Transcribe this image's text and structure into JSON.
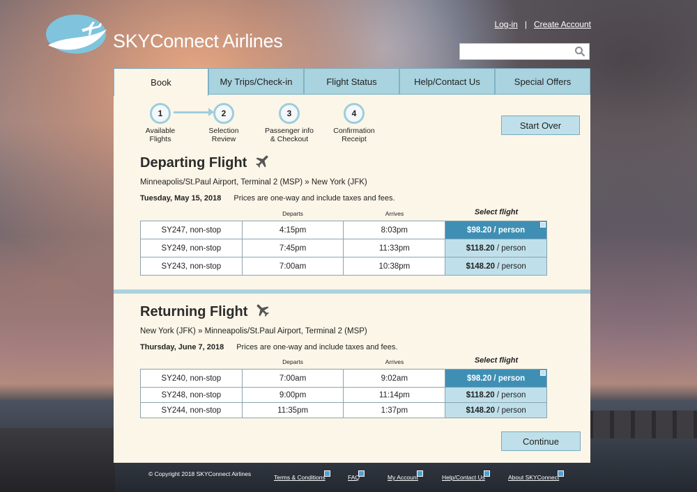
{
  "brand": {
    "name": "SKYConnect Airlines"
  },
  "header": {
    "login_label": "Log-in",
    "separator": "|",
    "create_account_label": "Create Account",
    "search_value": ""
  },
  "tabs": [
    {
      "label": "Book",
      "active": true
    },
    {
      "label": "My Trips/Check-in"
    },
    {
      "label": "Flight Status"
    },
    {
      "label": "Help/Contact Us"
    },
    {
      "label": "Special Offers"
    }
  ],
  "steps": [
    {
      "num": "1",
      "line1": "Available",
      "line2": "Flights"
    },
    {
      "num": "2",
      "line1": "Selection",
      "line2": "Review"
    },
    {
      "num": "3",
      "line1": "Passenger info",
      "line2": "& Checkout"
    },
    {
      "num": "4",
      "line1": "Confirmation",
      "line2": "Receipt"
    }
  ],
  "start_over_label": "Start Over",
  "columns": {
    "departs": "Departs",
    "arrives": "Arrives",
    "select": "Select flight"
  },
  "departing": {
    "title": "Departing Flight",
    "route": "Minneapolis/St.Paul Airport, Terminal 2 (MSP)  »  New York (JFK)",
    "date": "Tuesday, May 15, 2018",
    "note": "Prices are one-way and include taxes and fees.",
    "flights": [
      {
        "flight": "SY247, non-stop",
        "departs": "4:15pm",
        "arrives": "8:03pm",
        "price": "$98.20",
        "per": " / person",
        "selected": true
      },
      {
        "flight": "SY249, non-stop",
        "departs": "7:45pm",
        "arrives": "11:33pm",
        "price": "$118.20",
        "per": " / person"
      },
      {
        "flight": "SY243, non-stop",
        "departs": "7:00am",
        "arrives": "10:38pm",
        "price": "$148.20",
        "per": " / person"
      }
    ]
  },
  "returning": {
    "title": "Returning Flight",
    "route": "New York (JFK)  »  Minneapolis/St.Paul Airport, Terminal 2 (MSP)",
    "date": "Thursday, June 7, 2018",
    "note": "Prices are one-way and include taxes and fees.",
    "flights": [
      {
        "flight": "SY240, non-stop",
        "departs": "7:00am",
        "arrives": "9:02am",
        "price": "$98.20",
        "per": " / person",
        "selected": true
      },
      {
        "flight": "SY248, non-stop",
        "departs": "9:00pm",
        "arrives": "11:14pm",
        "price": "$118.20",
        "per": " / person"
      },
      {
        "flight": "SY244, non-stop",
        "departs": "11:35pm",
        "arrives": "1:37pm",
        "price": "$148.20",
        "per": " / person"
      }
    ]
  },
  "continue_label": "Continue",
  "footer": {
    "copyright": "© Copyright 2018 SKYConnect Airlines",
    "links": [
      "Terms & Conditions",
      "FAQ",
      "My Account",
      "Help/Contact Us",
      "About SKYConnect"
    ]
  },
  "colors": {
    "accent": "#a9d3df",
    "selected": "#3f8fb5",
    "panel": "#fbf6e8"
  }
}
